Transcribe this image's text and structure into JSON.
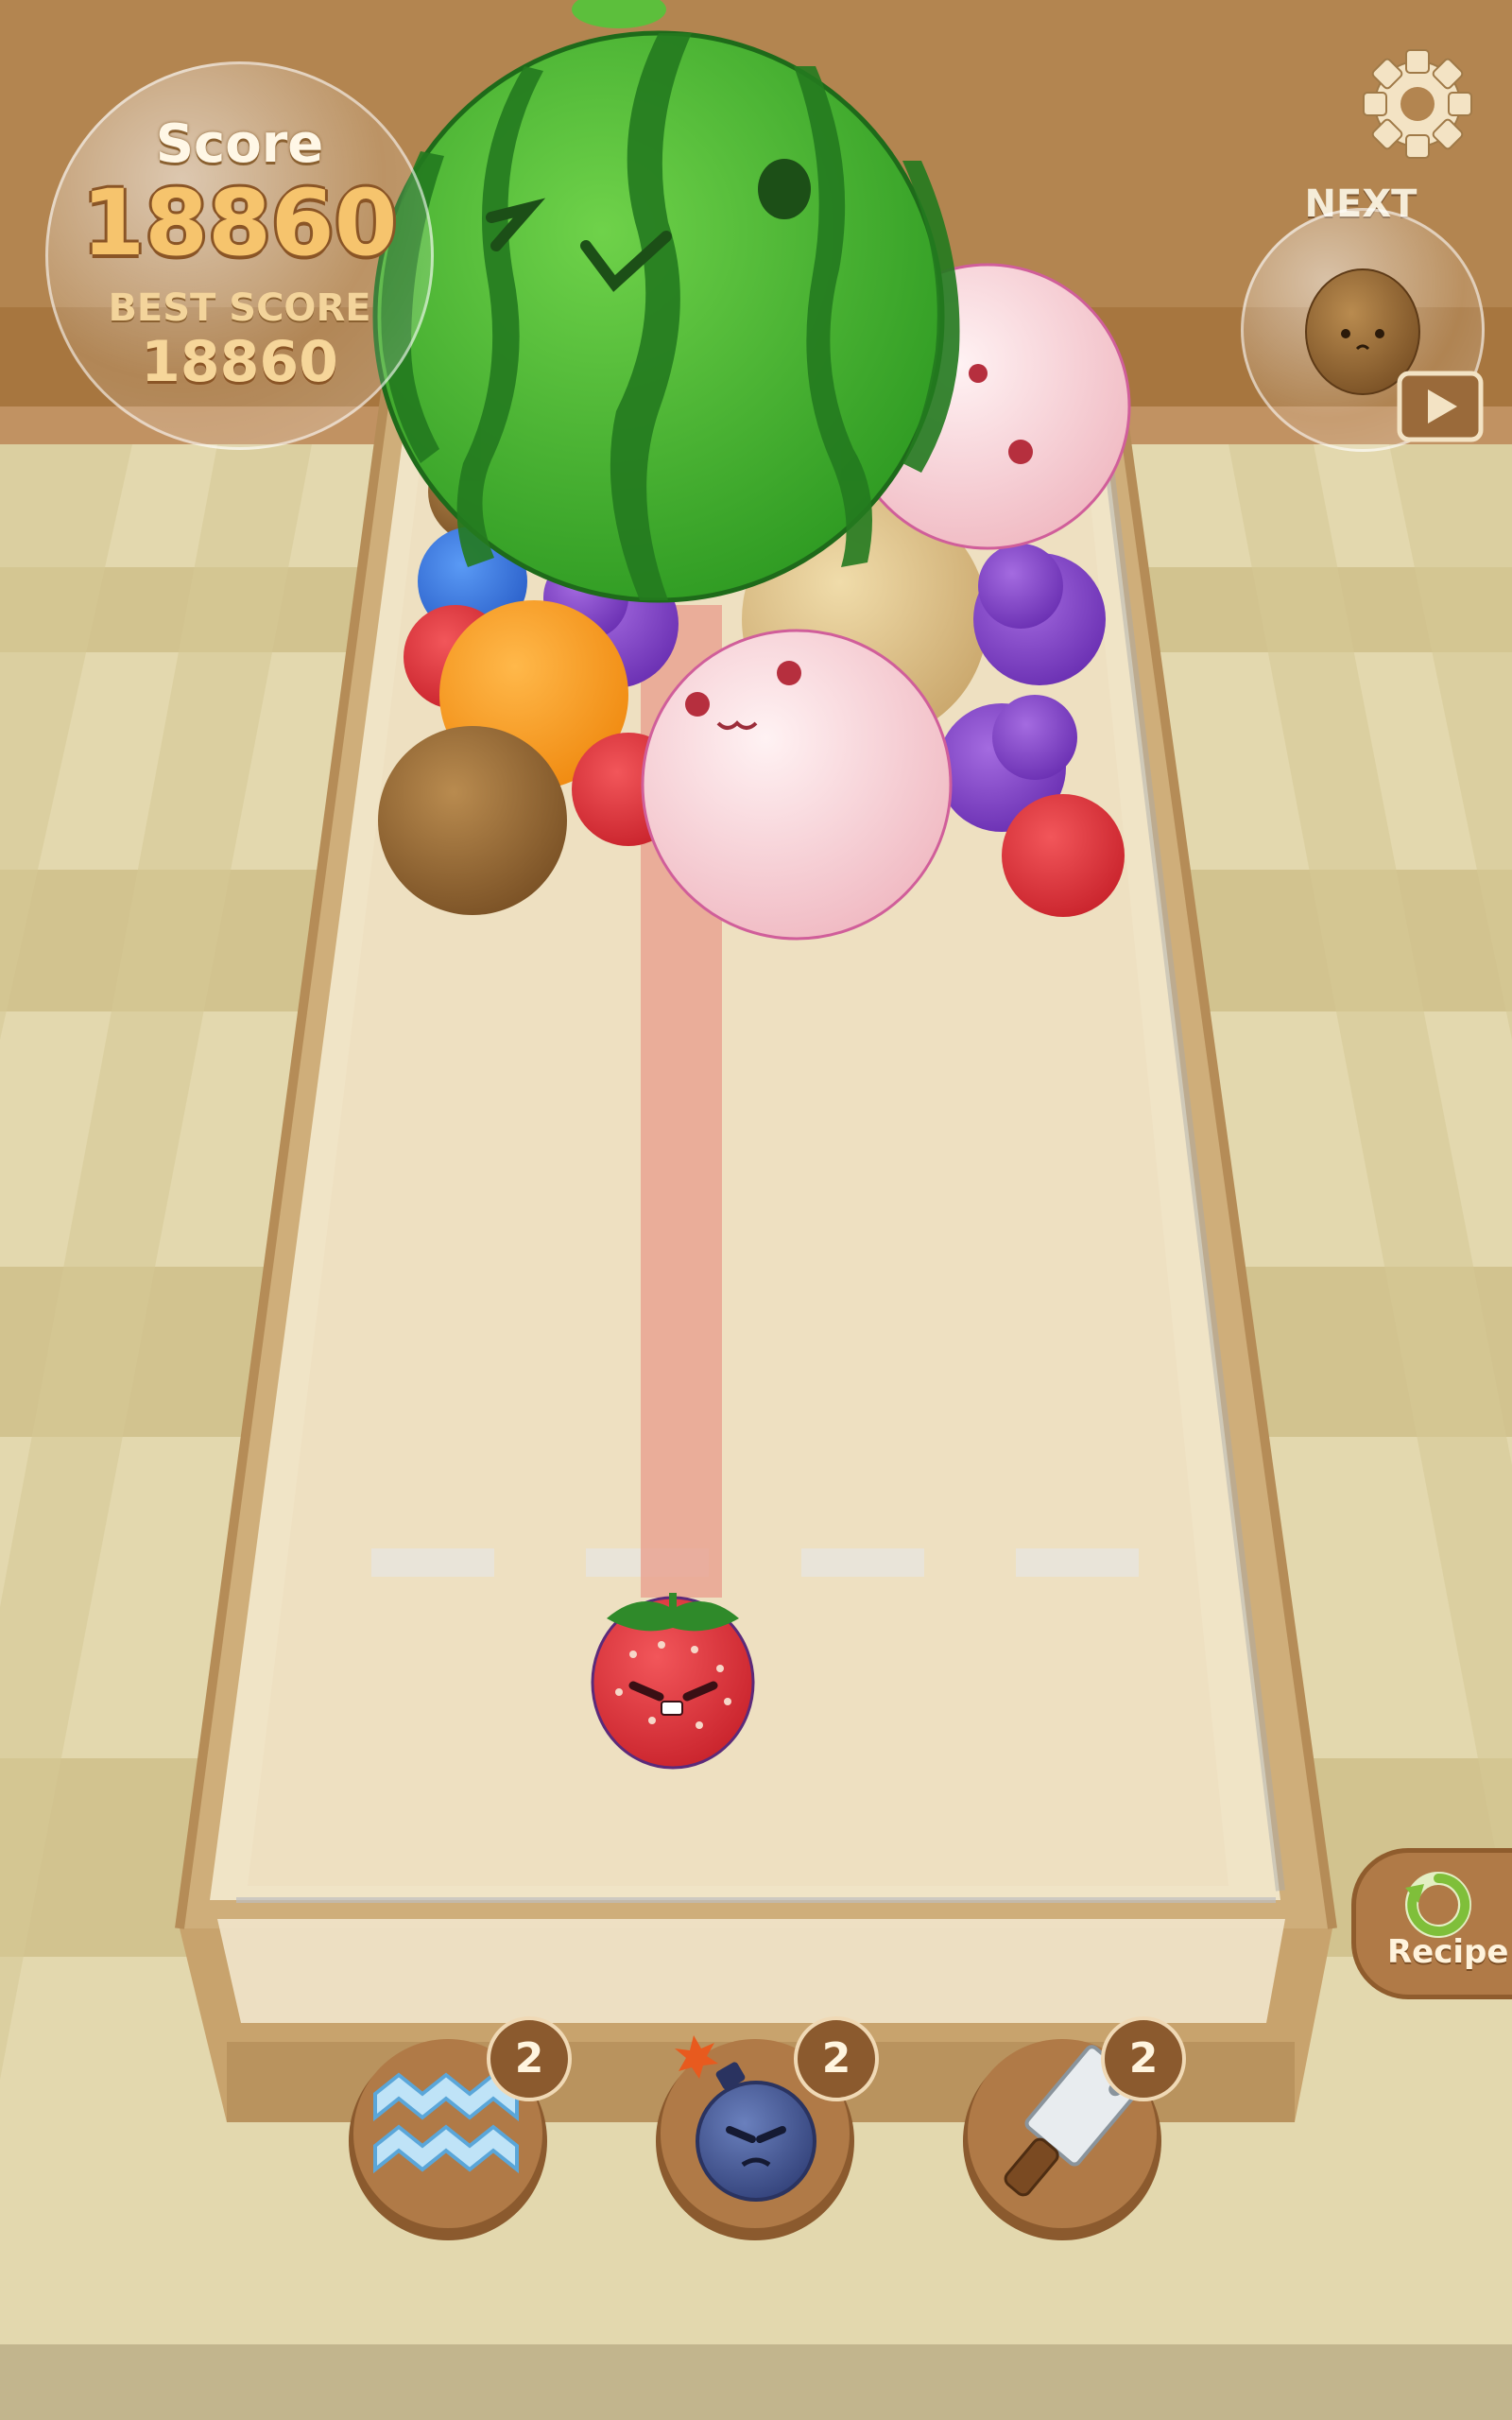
{
  "hud": {
    "score_label": "Score",
    "score_value": "18860",
    "best_score_label": "BEST SCORE",
    "best_score_value": "18860",
    "next_label": "NEXT",
    "next_fruit_icon": "kiwi-icon",
    "settings_icon": "gear-icon",
    "video_icon": "play-icon"
  },
  "current_fruit": "strawberry",
  "board_fruits": [
    "watermelon",
    "peach",
    "peach",
    "melon",
    "kiwi",
    "orange",
    "grapes",
    "grapes",
    "grapes",
    "strawberry",
    "strawberry",
    "strawberry",
    "strawberry",
    "blueberry"
  ],
  "recipe": {
    "label": "Recipe",
    "icon": "refresh-icon"
  },
  "tools": [
    {
      "name": "wave",
      "icon": "wave-icon",
      "count": "2"
    },
    {
      "name": "bomb",
      "icon": "bomb-icon",
      "count": "2"
    },
    {
      "name": "cleaver",
      "icon": "cleaver-icon",
      "count": "2"
    }
  ],
  "colors": {
    "wall": "#b38550",
    "floor_light": "#e6dcb4",
    "floor_dark": "#cfc18c",
    "tray_floor": "#efe2c5",
    "aim_line": "#e8a08e",
    "button_brown": "#b07a47"
  }
}
